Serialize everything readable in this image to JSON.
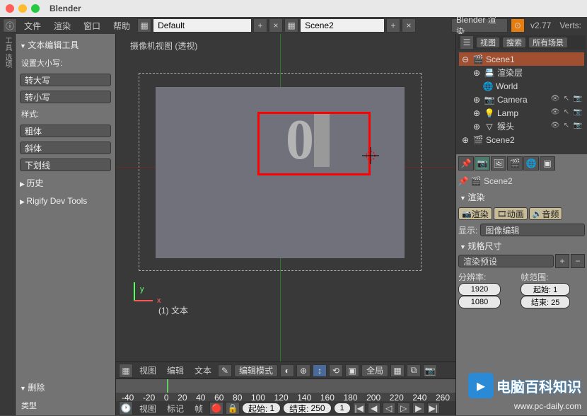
{
  "title": "Blender",
  "menubar": {
    "file": "文件",
    "render": "渲染",
    "window": "窗口",
    "help": "帮助"
  },
  "header": {
    "layout": "Default",
    "scene": "Scene2",
    "engine": "Blender 渲染",
    "version": "v2.77",
    "stats": "Verts:"
  },
  "tools": {
    "panel_text": "文本编辑工具",
    "case_label": "设置大小写:",
    "upper": "转大写",
    "lower": "转小写",
    "style_label": "样式:",
    "bold": "粗体",
    "italic": "斜体",
    "underline": "下划线",
    "history": "历史",
    "rigify": "Rigify Dev Tools",
    "delete": "删除",
    "misc": "类型"
  },
  "viewport": {
    "camera_label": "摄像机视图 (透视)",
    "object_label": "(1) 文本",
    "text_content": "0",
    "axis_x": "x",
    "axis_y": "y",
    "menu_view": "视图",
    "menu_edit": "编辑",
    "menu_text": "文本",
    "mode": "编辑模式",
    "shading": "全局"
  },
  "timeline": {
    "frames": [
      "-40",
      "-20",
      "0",
      "20",
      "40",
      "60",
      "80",
      "100",
      "120",
      "140",
      "160",
      "180",
      "200",
      "220",
      "240",
      "260"
    ],
    "menu_view": "视图",
    "menu_marker": "标记",
    "menu_frame": "帧",
    "start_label": "起始:",
    "start_val": "1",
    "end_label": "结束:",
    "end_val": "250",
    "cur_val": "1"
  },
  "outliner": {
    "view": "视图",
    "search": "搜索",
    "filter": "所有场景",
    "scene1": "Scene1",
    "renderlayers": "渲染层",
    "world": "World",
    "camera": "Camera",
    "lamp": "Lamp",
    "monkey": "猴头",
    "scene2": "Scene2"
  },
  "props": {
    "scene": "Scene2",
    "render_panel": "渲染",
    "render_btn": "渲染",
    "anim_btn": "动画",
    "audio_btn": "音频",
    "display_label": "显示:",
    "display_val": "图像编辑",
    "dims_panel": "规格尺寸",
    "preset": "渲染预设",
    "res_label": "分辨率:",
    "res_x": "1920",
    "res_y": "1080",
    "frame_label": "帧范围:",
    "frame_start": "起始: 1",
    "frame_end": "结束: 25"
  },
  "watermark": {
    "brand": "电脑百科知识",
    "url": "www.pc-daily.com"
  }
}
